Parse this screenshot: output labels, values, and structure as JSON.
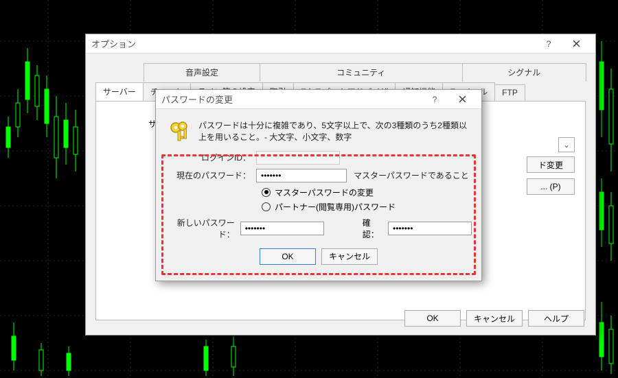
{
  "options_dialog": {
    "title": "オプション",
    "tabs_top": [
      "音声設定",
      "コミュニティ",
      "シグナル"
    ],
    "tabs_bottom": [
      "サーバー",
      "チャート",
      "ライン等の設定",
      "取引",
      "Eキスパートアドバイザ",
      "通知機能",
      "E - メール",
      "FTP"
    ],
    "active_tab": "サーバー",
    "side_label": "サ",
    "side_btn_login": "ド変更",
    "side_btn_test": "... (P)",
    "buttons": {
      "ok": "OK",
      "cancel": "キャンセル",
      "help": "ヘルプ"
    }
  },
  "pw_dialog": {
    "title": "パスワードの変更",
    "info": "パスワードは十分に複雑であり、5文字以上で、次の3種類のうち2種類以上を用いること。- 大文字、小文字、数字",
    "labels": {
      "login_id": "ログインID：",
      "current_pw": "現在のパスワード：",
      "master_hint": "マスターパスワードであること",
      "radio_master": "マスターパスワードの変更",
      "radio_partner": "パートナー(閲覧専用)パスワード",
      "new_pw": "新しいパスワード：",
      "confirm": "確認："
    },
    "values": {
      "login_id": "",
      "current_pw": "•••••••",
      "new_pw": "•••••••",
      "confirm_pw": "•••••••"
    },
    "buttons": {
      "ok": "OK",
      "cancel": "キャンセル"
    }
  }
}
